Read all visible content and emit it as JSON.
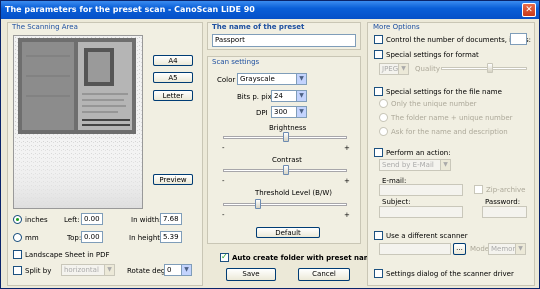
{
  "window": {
    "title": "The parameters for the preset scan - CanoScan LiDE 90",
    "close": "✕"
  },
  "scan_area": {
    "heading": "The Scanning Area",
    "buttons": {
      "a4": "A4",
      "a5": "A5",
      "letter": "Letter",
      "preview": "Preview"
    },
    "units": {
      "inches": "inches",
      "mm": "mm"
    },
    "left_label": "Left:",
    "left_value": "0.00",
    "top_label": "Top:",
    "top_value": "0.00",
    "width_label": "In width:",
    "width_value": "7.68",
    "height_label": "In height:",
    "height_value": "5.39",
    "landscape_label": "Landscape Sheet in PDF",
    "split_label": "Split by",
    "split_value": "horizontal",
    "rotate_label": "Rotate deg.",
    "rotate_value": "0"
  },
  "preset": {
    "heading": "The name of the preset",
    "name": "Passport"
  },
  "scan_settings": {
    "heading": "Scan settings",
    "color_label": "Color",
    "color_value": "Grayscale",
    "bits_label": "Bits p. pix.",
    "bits_value": "24",
    "dpi_label": "DPI",
    "dpi_value": "300",
    "brightness_label": "Brightness",
    "contrast_label": "Contrast",
    "threshold_label": "Threshold Level (B/W)",
    "minus": "-",
    "plus": "+",
    "default_label": "Default"
  },
  "bottom": {
    "auto_folder_label": "Auto create folder with preset name",
    "save_label": "Save",
    "cancel_label": "Cancel"
  },
  "more_options": {
    "heading": "More Options",
    "control_label": "Control the number of documents, items:",
    "format_label": "Special settings for format",
    "format_value": "JPEG",
    "quality_label": "Quality",
    "filename_label": "Special settings for the file name",
    "only_unique": "Only the unique number",
    "folder_unique": "The folder name + unique number",
    "ask_name": "Ask for the name and description",
    "action_label": "Perform an action:",
    "action_value": "Send by E-Mail",
    "email_label": "E-mail:",
    "zip_label": "Zip-archive",
    "subject_label": "Subject:",
    "password_label": "Password:",
    "diff_scanner_label": "Use a different scanner",
    "browse_label": "...",
    "mode_label": "Mode:",
    "mode_value": "Memory",
    "driver_dialog_label": "Settings dialog of the scanner driver"
  },
  "icons": {
    "dropdown": "chevron-down-icon",
    "close": "close-icon"
  },
  "colors": {
    "title_bar": "#0a5fd8",
    "heading": "#1d4fa0",
    "background": "#ece9d8"
  }
}
